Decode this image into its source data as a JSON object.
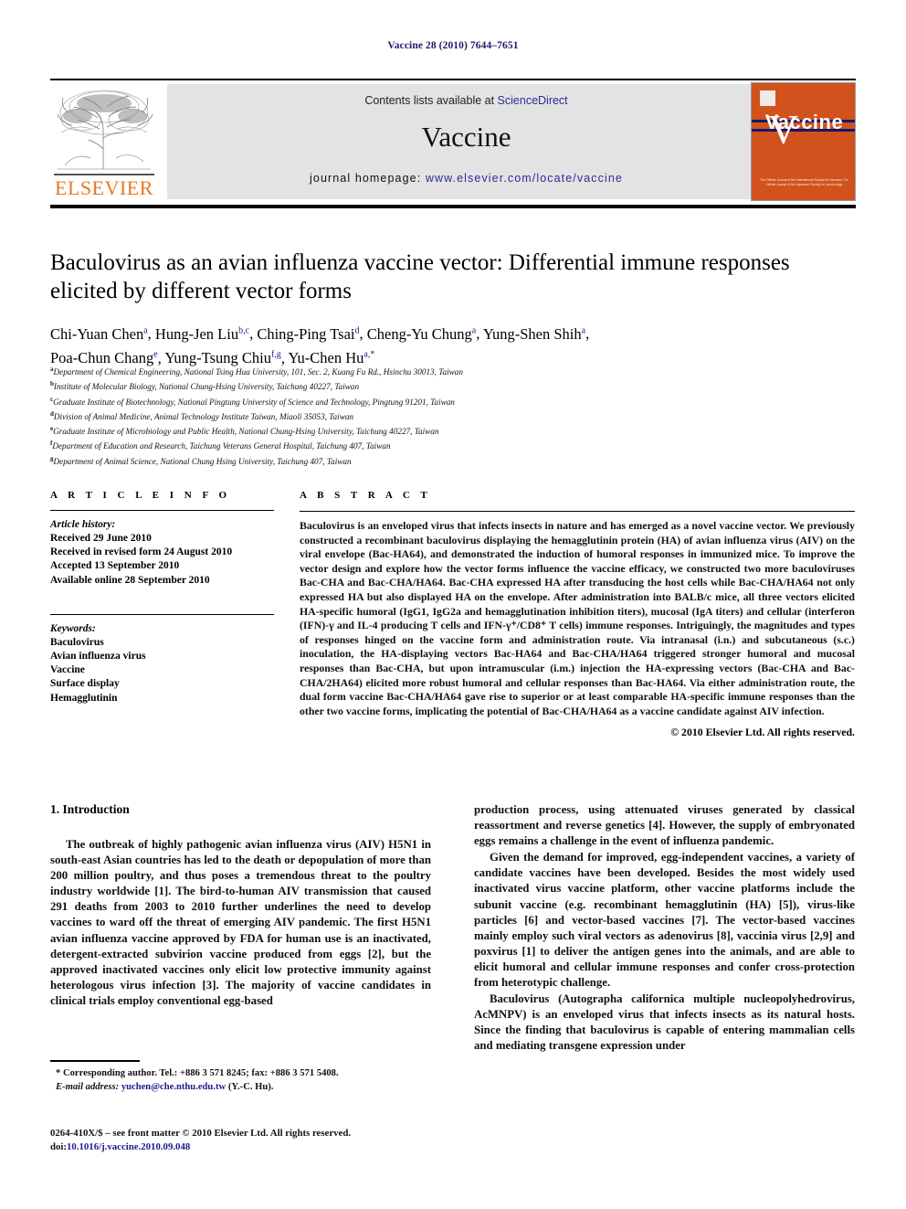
{
  "running_head": "Vaccine 28 (2010) 7644–7651",
  "masthead": {
    "contents_prefix": "Contents lists available at ",
    "sciencedirect": "ScienceDirect",
    "journal_name": "Vaccine",
    "homepage_prefix": "journal homepage: ",
    "homepage_url": "www.elsevier.com/locate/vaccine",
    "elsevier_wordmark": "ELSEVIER",
    "cover_title": "Vaccine",
    "cover_footer": "The Official Journal of the International Society for Vaccines\nThe Official Journal of the Japanese Society for Vaccinology",
    "accent_orange": "#E87722",
    "link_blue": "#2b2b9e"
  },
  "article": {
    "title": "Baculovirus as an avian influenza vaccine vector: Differential immune responses elicited by different vector forms",
    "authors_line_1": "Chi-Yuan Chen",
    "authors": [
      {
        "name": "Chi-Yuan Chen",
        "marks": "a"
      },
      {
        "name": "Hung-Jen Liu",
        "marks": "b,c"
      },
      {
        "name": "Ching-Ping Tsai",
        "marks": "d"
      },
      {
        "name": "Cheng-Yu Chung",
        "marks": "a"
      },
      {
        "name": "Yung-Shen Shih",
        "marks": "a"
      },
      {
        "name": "Poa-Chun Chang",
        "marks": "e"
      },
      {
        "name": "Yung-Tsung Chiu",
        "marks": "f,g"
      },
      {
        "name": "Yu-Chen Hu",
        "marks": "a,*"
      }
    ],
    "affiliations": [
      {
        "mark": "a",
        "text": "Department of Chemical Engineering, National Tsing Hua University, 101, Sec. 2, Kuang Fu Rd., Hsinchu 30013, Taiwan"
      },
      {
        "mark": "b",
        "text": "Institute of Molecular Biology, National Chung-Hsing University, Taichung 40227, Taiwan"
      },
      {
        "mark": "c",
        "text": "Graduate Institute of Biotechnology, National Pingtung University of Science and Technology, Pingtung 91201, Taiwan"
      },
      {
        "mark": "d",
        "text": "Division of Animal Medicine, Animal Technology Institute Taiwan, Miaoli 35053, Taiwan"
      },
      {
        "mark": "e",
        "text": "Graduate Institute of Microbiology and Public Health, National Chung-Hsing University, Taichung 40227, Taiwan"
      },
      {
        "mark": "f",
        "text": "Department of Education and Research, Taichung Veterans General Hospital, Taichung 407, Taiwan"
      },
      {
        "mark": "g",
        "text": "Department of Animal Science, National Chung Hsing University, Taichung 407, Taiwan"
      }
    ]
  },
  "article_info": {
    "heading": "A R T I C L E   I N F O",
    "history_label": "Article history:",
    "history": [
      "Received 29 June 2010",
      "Received in revised form 24 August 2010",
      "Accepted 13 September 2010",
      "Available online 28 September 2010"
    ],
    "keywords_label": "Keywords:",
    "keywords": [
      "Baculovirus",
      "Avian influenza virus",
      "Vaccine",
      "Surface display",
      "Hemagglutinin"
    ]
  },
  "abstract": {
    "heading": "A B S T R A C T",
    "text": "Baculovirus is an enveloped virus that infects insects in nature and has emerged as a novel vaccine vector. We previously constructed a recombinant baculovirus displaying the hemagglutinin protein (HA) of avian influenza virus (AIV) on the viral envelope (Bac-HA64), and demonstrated the induction of humoral responses in immunized mice. To improve the vector design and explore how the vector forms influence the vaccine efficacy, we constructed two more baculoviruses Bac-CHA and Bac-CHA/HA64. Bac-CHA expressed HA after transducing the host cells while Bac-CHA/HA64 not only expressed HA but also displayed HA on the envelope. After administration into BALB/c mice, all three vectors elicited HA-specific humoral (IgG1, IgG2a and hemagglutination inhibition titers), mucosal (IgA titers) and cellular (interferon (IFN)-γ and IL-4 producing T cells and IFN-γ⁺/CD8⁺ T cells) immune responses. Intriguingly, the magnitudes and types of responses hinged on the vaccine form and administration route. Via intranasal (i.n.) and subcutaneous (s.c.) inoculation, the HA-displaying vectors Bac-HA64 and Bac-CHA/HA64 triggered stronger humoral and mucosal responses than Bac-CHA, but upon intramuscular (i.m.) injection the HA-expressing vectors (Bac-CHA and Bac-CHA/2HA64) elicited more robust humoral and cellular responses than Bac-HA64. Via either administration route, the dual form vaccine Bac-CHA/HA64 gave rise to superior or at least comparable HA-specific immune responses than the other two vaccine forms, implicating the potential of Bac-CHA/HA64 as a vaccine candidate against AIV infection.",
    "copyright": "© 2010 Elsevier Ltd. All rights reserved."
  },
  "body": {
    "section_heading": "1. Introduction",
    "left_paragraphs": [
      "The outbreak of highly pathogenic avian influenza virus (AIV) H5N1 in south-east Asian countries has led to the death or depopulation of more than 200 million poultry, and thus poses a tremendous threat to the poultry industry worldwide [1]. The bird-to-human AIV transmission that caused 291 deaths from 2003 to 2010 further underlines the need to develop vaccines to ward off the threat of emerging AIV pandemic. The first H5N1 avian influenza vaccine approved by FDA for human use is an inactivated, detergent-extracted subvirion vaccine produced from eggs [2], but the approved inactivated vaccines only elicit low protective immunity against heterologous virus infection [3]. The majority of vaccine candidates in clinical trials employ conventional egg-based"
    ],
    "right_paragraphs": [
      "production process, using attenuated viruses generated by classical reassortment and reverse genetics [4]. However, the supply of embryonated eggs remains a challenge in the event of influenza pandemic.",
      "Given the demand for improved, egg-independent vaccines, a variety of candidate vaccines have been developed. Besides the most widely used inactivated virus vaccine platform, other vaccine platforms include the subunit vaccine (e.g. recombinant hemagglutinin (HA) [5]), virus-like particles [6] and vector-based vaccines [7]. The vector-based vaccines mainly employ such viral vectors as adenovirus [8], vaccinia virus [2,9] and poxvirus [1] to deliver the antigen genes into the animals, and are able to elicit humoral and cellular immune responses and confer cross-protection from heterotypic challenge.",
      "Baculovirus (Autographa californica multiple nucleopolyhedrovirus, AcMNPV) is an enveloped virus that infects insects as its natural hosts. Since the finding that baculovirus is capable of entering mammalian cells and mediating transgene expression under"
    ]
  },
  "footnotes": {
    "corresponding": "* Corresponding author. Tel.: +886 3 571 8245; fax: +886 3 571 5408.",
    "email_label": "E-mail address:",
    "email": "yuchen@che.nthu.edu.tw",
    "email_suffix": "(Y.-C. Hu).",
    "imprint": "0264-410X/$ – see front matter © 2010 Elsevier Ltd. All rights reserved.",
    "doi_label": "doi:",
    "doi": "10.1016/j.vaccine.2010.09.048"
  }
}
